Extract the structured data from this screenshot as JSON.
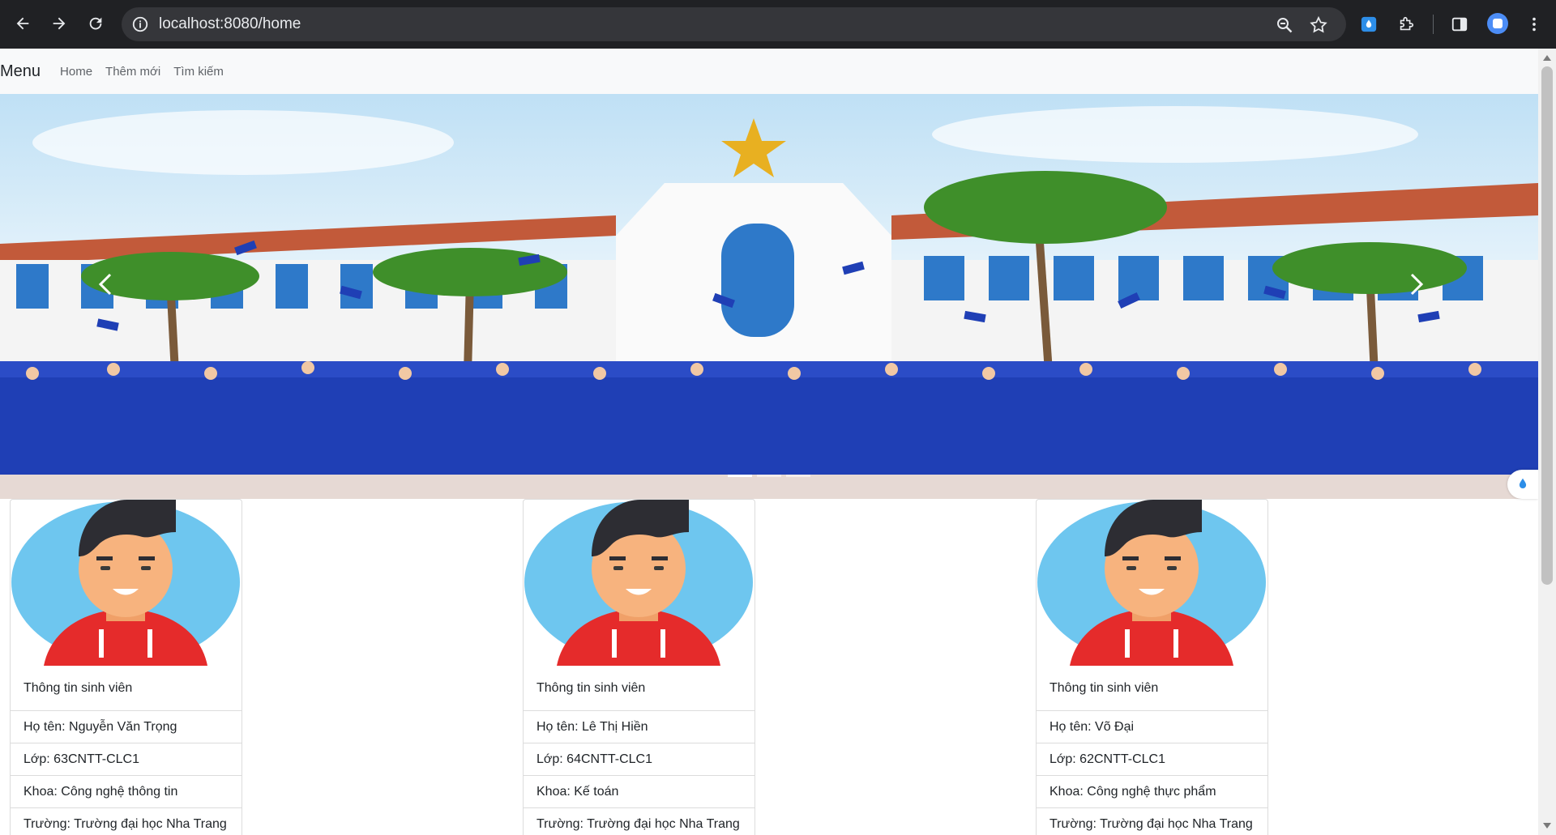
{
  "browser": {
    "url": "localhost:8080/home",
    "icons": [
      "back-icon",
      "forward-icon",
      "reload-icon",
      "info-icon",
      "zoom-icon",
      "bookmark-star-icon",
      "extension-icon",
      "extensions-puzzle-icon",
      "side-panel-icon",
      "profile-icon",
      "menu-kebab-icon"
    ]
  },
  "navbar": {
    "brand": "Menu",
    "links": [
      "Home",
      "Thêm mới",
      "Tìm kiếm"
    ]
  },
  "carousel": {
    "indicators_count": 3,
    "active_indicator": 1
  },
  "cards": [
    {
      "title": "Thông tin sinh viên",
      "name": "Họ tên: Nguyễn Văn Trọng",
      "class": "Lớp: 63CNTT-CLC1",
      "faculty": "Khoa: Công nghệ thông tin",
      "school": "Trường: Trường đại học Nha Trang"
    },
    {
      "title": "Thông tin sinh viên",
      "name": "Họ tên: Lê Thị Hiền",
      "class": "Lớp: 64CNTT-CLC1",
      "faculty": "Khoa: Kế toán",
      "school": "Trường: Trường đại học Nha Trang"
    },
    {
      "title": "Thông tin sinh viên",
      "name": "Họ tên: Võ Đại",
      "class": "Lớp: 62CNTT-CLC1",
      "faculty": "Khoa: Công nghệ thực phẩm",
      "school": "Trường: Trường đại học Nha Trang"
    }
  ],
  "colors": {
    "chrome": "#202124",
    "omnibox": "#35363a",
    "navbar": "#f8f9fa",
    "gown_blue": "#1f3fb5",
    "hoodie_red": "#e52b2b"
  }
}
